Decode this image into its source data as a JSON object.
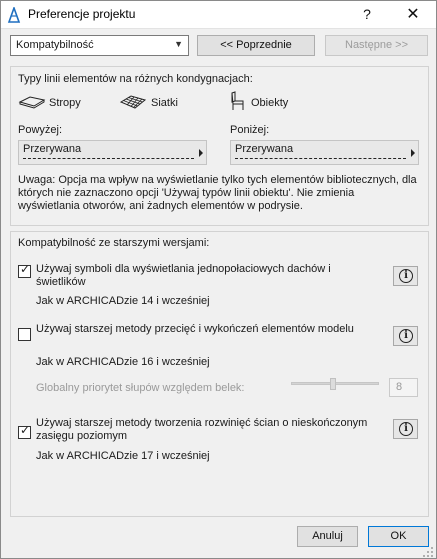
{
  "window": {
    "title": "Preferencje projektu",
    "help_label": "?",
    "close_label": "✕"
  },
  "toolbar": {
    "page_select_value": "Kompatybilność",
    "prev_label": "<< Poprzednie",
    "next_label": "Następne >>"
  },
  "line_types": {
    "heading": "Typy linii elementów na różnych kondygnacjach:",
    "categories": [
      {
        "label": "Stropy",
        "icon": "slab-icon"
      },
      {
        "label": "Siatki",
        "icon": "mesh-icon"
      },
      {
        "label": "Obiekty",
        "icon": "object-chair-icon"
      }
    ],
    "above": {
      "label": "Powyżej:",
      "value": "Przerywana"
    },
    "below": {
      "label": "Poniżej:",
      "value": "Przerywana"
    },
    "note": "Uwaga: Opcja ma wpływ na wyświetlanie tylko tych elementów bibliotecznych, dla których nie zaznaczono opcji 'Używaj typów linii obiektu'. Nie zmienia wyświetlania otworów, ani żadnych elementów w podrysie."
  },
  "compat": {
    "heading": "Kompatybilność ze starszymi wersjami:",
    "options": [
      {
        "label": "Używaj symboli dla wyświetlania jednopołaciowych dachów i świetlików",
        "checked": true,
        "sub": "Jak w ARCHICADzie 14 i wcześniej"
      },
      {
        "label": "Używaj starszej metody przecięć i wykończeń elementów modelu",
        "checked": false,
        "sub": "Jak w ARCHICADzie 16 i wcześniej"
      },
      {
        "label": "Używaj starszej metody tworzenia rozwinięć ścian o nieskończonym zasięgu poziomym",
        "checked": true,
        "sub": "Jak w ARCHICADzie 17 i wcześniej"
      }
    ],
    "priority_label": "Globalny priorytet słupów względem belek:",
    "priority_value": "8",
    "priority_level": 0.5
  },
  "footer": {
    "cancel_label": "Anuluj",
    "ok_label": "OK"
  },
  "colors": {
    "window_bg": "#f0f0f0",
    "accent_ok_border": "#0078d7",
    "disabled_text": "#9a9a9a"
  }
}
